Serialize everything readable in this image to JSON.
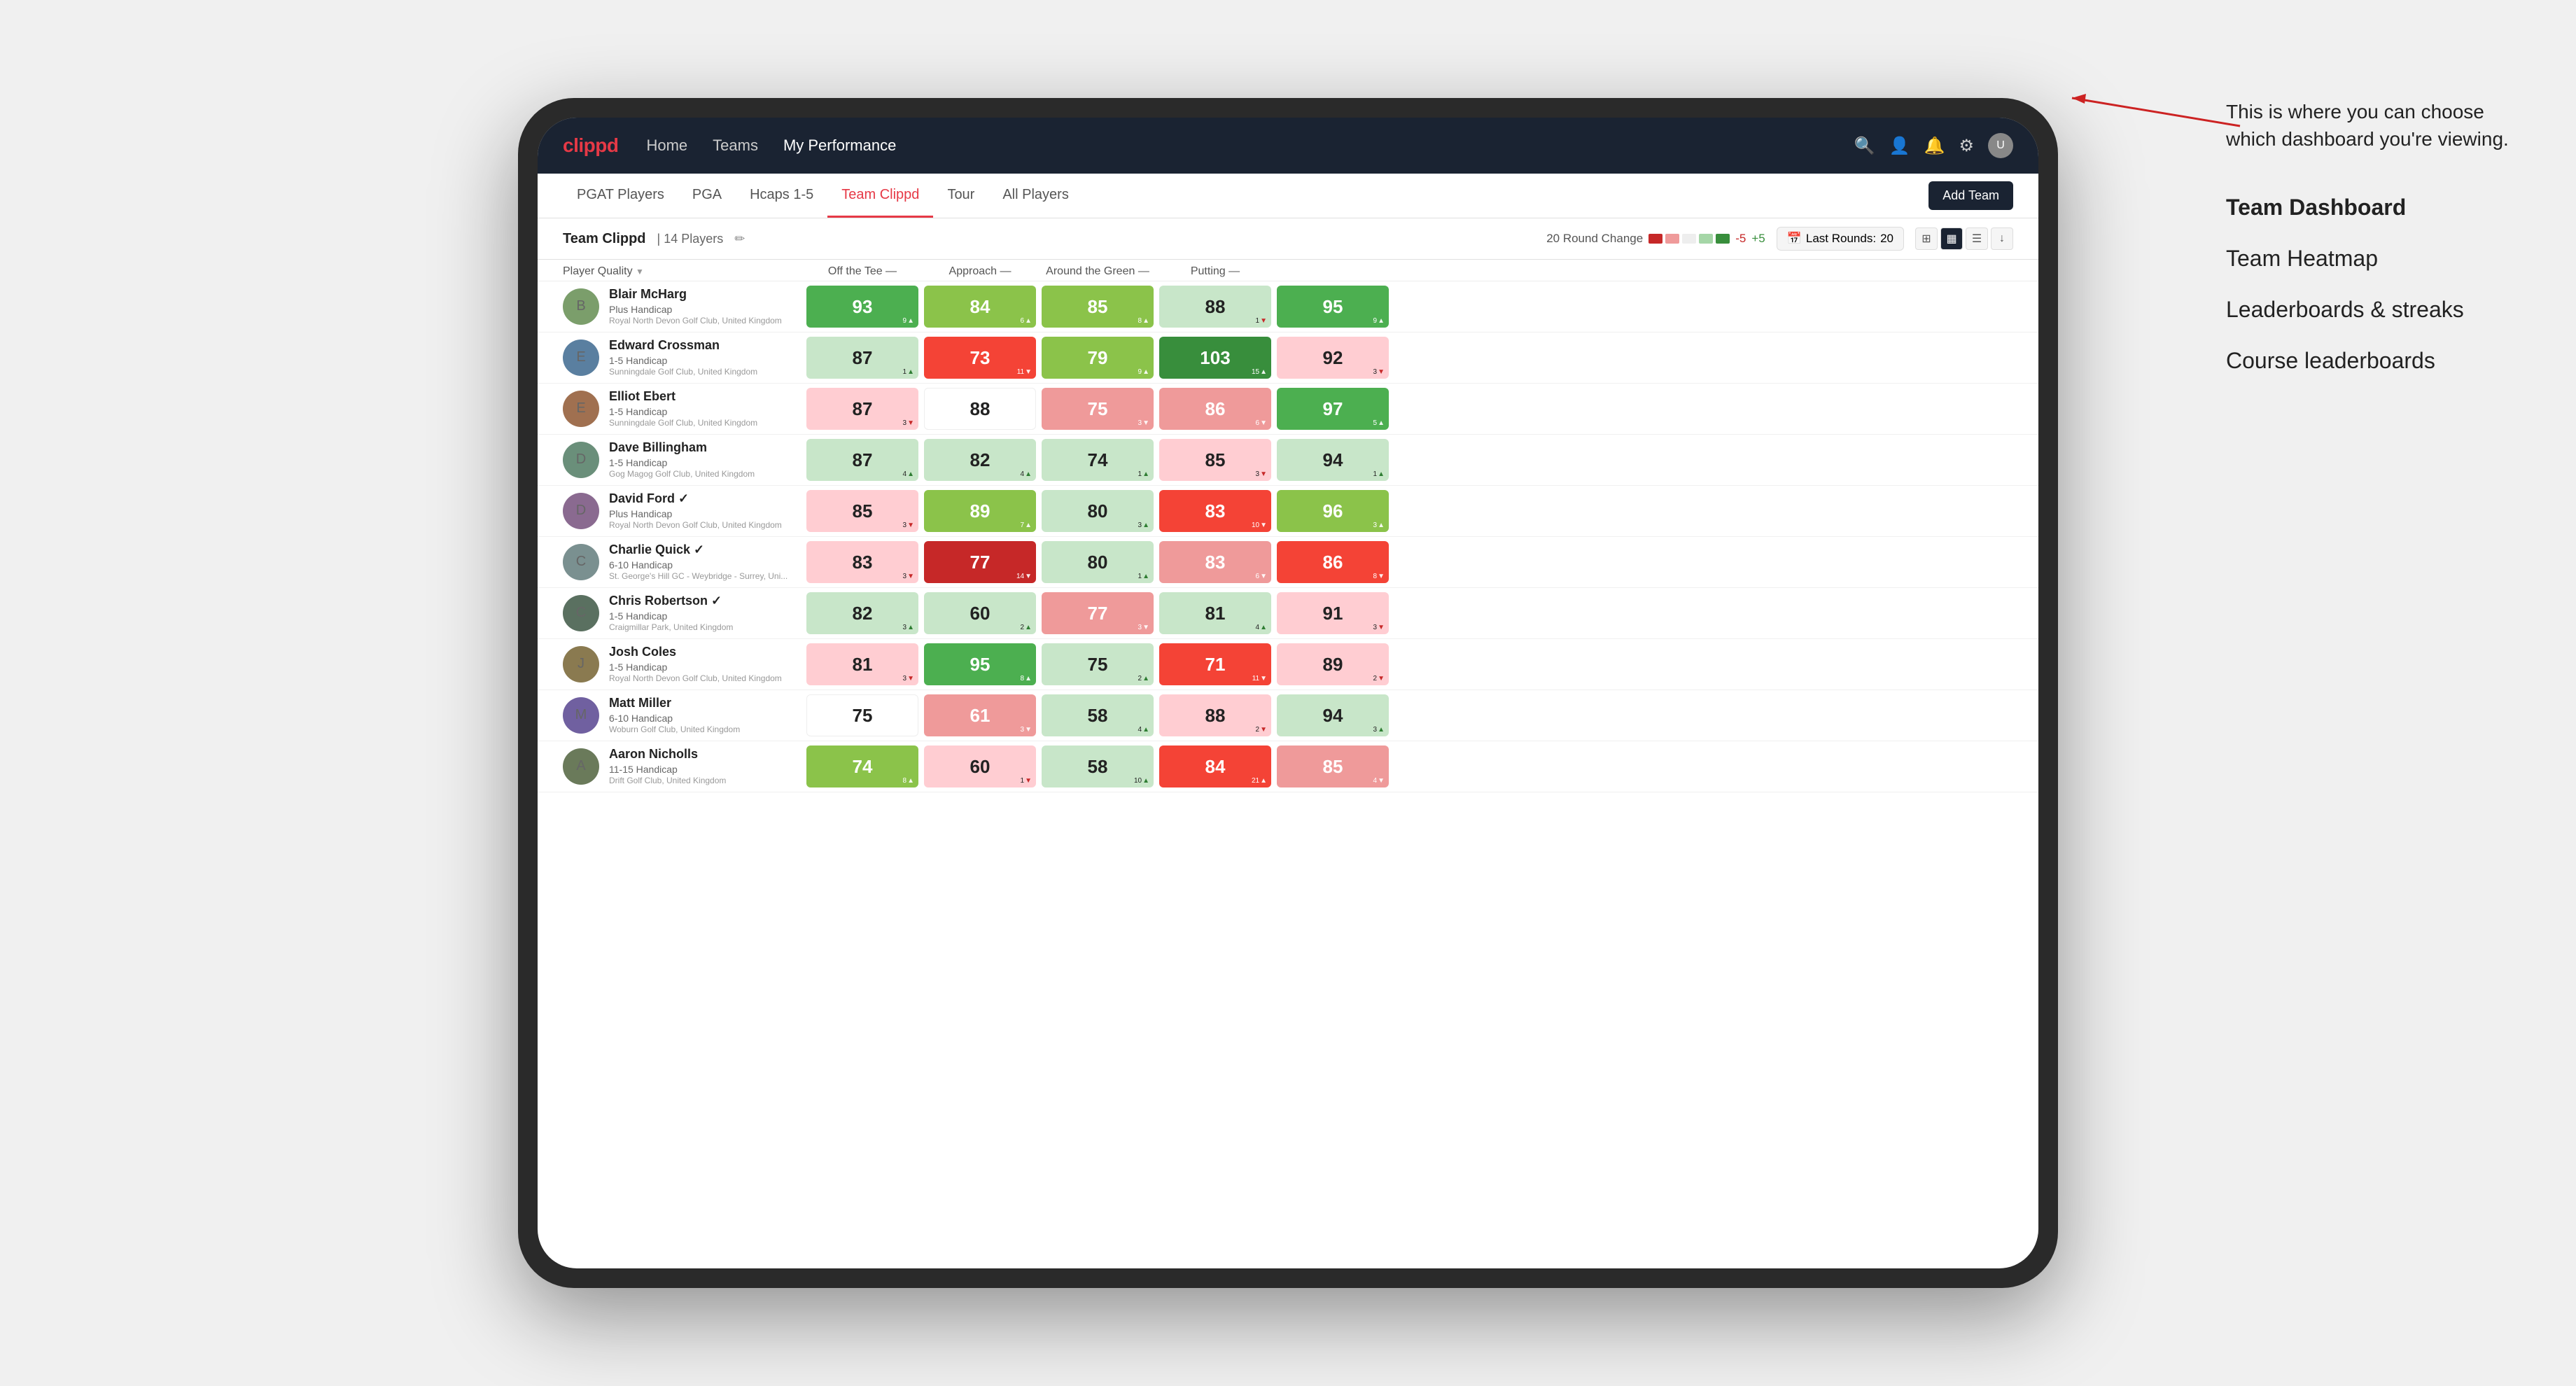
{
  "annotation": {
    "callout": "This is where you can choose which dashboard you're viewing.",
    "options": [
      {
        "label": "Team Dashboard",
        "active": true
      },
      {
        "label": "Team Heatmap",
        "active": false
      },
      {
        "label": "Leaderboards & streaks",
        "active": false
      },
      {
        "label": "Course leaderboards",
        "active": false
      }
    ]
  },
  "nav": {
    "logo": "clippd",
    "items": [
      "Home",
      "Teams",
      "My Performance"
    ],
    "active_item": "My Performance"
  },
  "tabs": {
    "items": [
      "PGAT Players",
      "PGA",
      "Hcaps 1-5",
      "Team Clippd",
      "Tour",
      "All Players"
    ],
    "active": "Team Clippd",
    "add_button": "Add Team"
  },
  "team_header": {
    "name": "Team Clippd",
    "separator": "|",
    "count": "14 Players",
    "round_change_label": "20 Round Change",
    "change_minus": "-5",
    "change_plus": "+5",
    "last_rounds_label": "Last Rounds:",
    "last_rounds_value": "20"
  },
  "column_headers": [
    {
      "label": "Player Quality",
      "arrow": "▼",
      "key": "player"
    },
    {
      "label": "Off the Tee",
      "arrow": "—",
      "key": "off_tee"
    },
    {
      "label": "Approach",
      "arrow": "—",
      "key": "approach"
    },
    {
      "label": "Around the Green",
      "arrow": "—",
      "key": "around_green"
    },
    {
      "label": "Putting",
      "arrow": "—",
      "key": "putting"
    }
  ],
  "players": [
    {
      "name": "Blair McHarg",
      "handicap": "Plus Handicap",
      "club": "Royal North Devon Golf Club, United Kingdom",
      "scores": [
        {
          "value": "93",
          "change": "9",
          "direction": "up",
          "color": "green"
        },
        {
          "value": "84",
          "change": "6",
          "direction": "up",
          "color": "green-light"
        },
        {
          "value": "85",
          "change": "8",
          "direction": "up",
          "color": "green-light"
        },
        {
          "value": "88",
          "change": "1",
          "direction": "down",
          "color": "green-pale"
        },
        {
          "value": "95",
          "change": "9",
          "direction": "up",
          "color": "green"
        }
      ]
    },
    {
      "name": "Edward Crossman",
      "handicap": "1-5 Handicap",
      "club": "Sunningdale Golf Club, United Kingdom",
      "scores": [
        {
          "value": "87",
          "change": "1",
          "direction": "up",
          "color": "green-pale"
        },
        {
          "value": "73",
          "change": "11",
          "direction": "down",
          "color": "red"
        },
        {
          "value": "79",
          "change": "9",
          "direction": "up",
          "color": "green-light"
        },
        {
          "value": "103",
          "change": "15",
          "direction": "up",
          "color": "green-dark"
        },
        {
          "value": "92",
          "change": "3",
          "direction": "down",
          "color": "red-pale"
        }
      ]
    },
    {
      "name": "Elliot Ebert",
      "handicap": "1-5 Handicap",
      "club": "Sunningdale Golf Club, United Kingdom",
      "scores": [
        {
          "value": "87",
          "change": "3",
          "direction": "down",
          "color": "red-pale"
        },
        {
          "value": "88",
          "change": "",
          "direction": "",
          "color": "white"
        },
        {
          "value": "75",
          "change": "3",
          "direction": "down",
          "color": "red-light"
        },
        {
          "value": "86",
          "change": "6",
          "direction": "down",
          "color": "red-light"
        },
        {
          "value": "97",
          "change": "5",
          "direction": "up",
          "color": "green"
        }
      ]
    },
    {
      "name": "Dave Billingham",
      "handicap": "1-5 Handicap",
      "club": "Gog Magog Golf Club, United Kingdom",
      "scores": [
        {
          "value": "87",
          "change": "4",
          "direction": "up",
          "color": "green-pale"
        },
        {
          "value": "82",
          "change": "4",
          "direction": "up",
          "color": "green-pale"
        },
        {
          "value": "74",
          "change": "1",
          "direction": "up",
          "color": "green-pale"
        },
        {
          "value": "85",
          "change": "3",
          "direction": "down",
          "color": "red-pale"
        },
        {
          "value": "94",
          "change": "1",
          "direction": "up",
          "color": "green-pale"
        }
      ]
    },
    {
      "name": "David Ford",
      "handicap": "Plus Handicap",
      "club": "Royal North Devon Golf Club, United Kingdom",
      "verified": true,
      "scores": [
        {
          "value": "85",
          "change": "3",
          "direction": "down",
          "color": "red-pale"
        },
        {
          "value": "89",
          "change": "7",
          "direction": "up",
          "color": "green-light"
        },
        {
          "value": "80",
          "change": "3",
          "direction": "up",
          "color": "green-pale"
        },
        {
          "value": "83",
          "change": "10",
          "direction": "down",
          "color": "red"
        },
        {
          "value": "96",
          "change": "3",
          "direction": "up",
          "color": "green-light"
        }
      ]
    },
    {
      "name": "Charlie Quick",
      "handicap": "6-10 Handicap",
      "club": "St. George's Hill GC - Weybridge - Surrey, Uni...",
      "verified": true,
      "scores": [
        {
          "value": "83",
          "change": "3",
          "direction": "down",
          "color": "red-pale"
        },
        {
          "value": "77",
          "change": "14",
          "direction": "down",
          "color": "red-dark"
        },
        {
          "value": "80",
          "change": "1",
          "direction": "up",
          "color": "green-pale"
        },
        {
          "value": "83",
          "change": "6",
          "direction": "down",
          "color": "red-light"
        },
        {
          "value": "86",
          "change": "8",
          "direction": "down",
          "color": "red"
        }
      ]
    },
    {
      "name": "Chris Robertson",
      "handicap": "1-5 Handicap",
      "club": "Craigmillar Park, United Kingdom",
      "verified": true,
      "scores": [
        {
          "value": "82",
          "change": "3",
          "direction": "up",
          "color": "green-pale"
        },
        {
          "value": "60",
          "change": "2",
          "direction": "up",
          "color": "green-pale"
        },
        {
          "value": "77",
          "change": "3",
          "direction": "down",
          "color": "red-light"
        },
        {
          "value": "81",
          "change": "4",
          "direction": "up",
          "color": "green-pale"
        },
        {
          "value": "91",
          "change": "3",
          "direction": "down",
          "color": "red-pale"
        }
      ]
    },
    {
      "name": "Josh Coles",
      "handicap": "1-5 Handicap",
      "club": "Royal North Devon Golf Club, United Kingdom",
      "scores": [
        {
          "value": "81",
          "change": "3",
          "direction": "down",
          "color": "red-pale"
        },
        {
          "value": "95",
          "change": "8",
          "direction": "up",
          "color": "green"
        },
        {
          "value": "75",
          "change": "2",
          "direction": "up",
          "color": "green-pale"
        },
        {
          "value": "71",
          "change": "11",
          "direction": "down",
          "color": "red"
        },
        {
          "value": "89",
          "change": "2",
          "direction": "down",
          "color": "red-pale"
        }
      ]
    },
    {
      "name": "Matt Miller",
      "handicap": "6-10 Handicap",
      "club": "Woburn Golf Club, United Kingdom",
      "scores": [
        {
          "value": "75",
          "change": "",
          "direction": "",
          "color": "white"
        },
        {
          "value": "61",
          "change": "3",
          "direction": "down",
          "color": "red-light"
        },
        {
          "value": "58",
          "change": "4",
          "direction": "up",
          "color": "green-pale"
        },
        {
          "value": "88",
          "change": "2",
          "direction": "down",
          "color": "red-pale"
        },
        {
          "value": "94",
          "change": "3",
          "direction": "up",
          "color": "green-pale"
        }
      ]
    },
    {
      "name": "Aaron Nicholls",
      "handicap": "11-15 Handicap",
      "club": "Drift Golf Club, United Kingdom",
      "scores": [
        {
          "value": "74",
          "change": "8",
          "direction": "up",
          "color": "green-light"
        },
        {
          "value": "60",
          "change": "1",
          "direction": "down",
          "color": "red-pale"
        },
        {
          "value": "58",
          "change": "10",
          "direction": "up",
          "color": "green-pale"
        },
        {
          "value": "84",
          "change": "21",
          "direction": "up",
          "color": "red"
        },
        {
          "value": "85",
          "change": "4",
          "direction": "down",
          "color": "red-light"
        }
      ]
    }
  ]
}
